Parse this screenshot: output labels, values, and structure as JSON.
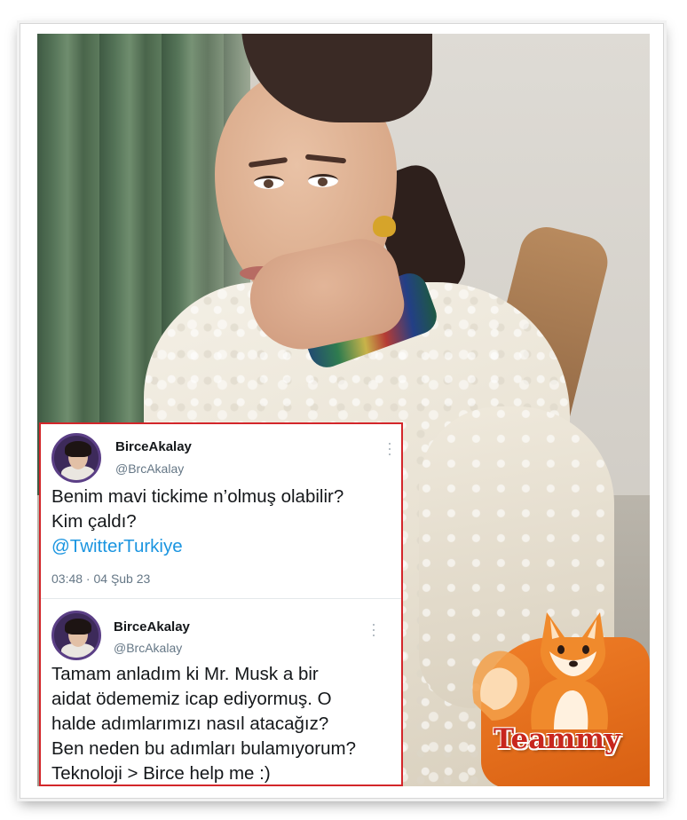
{
  "tweets": [
    {
      "display_name": "BirceAkalay",
      "handle": "@BrcAkalay",
      "text_line1": "Benim mavi tickime n’olmuş olabilir?",
      "text_line2": "Kim çaldı?",
      "mention": "@TwitterTurkiye",
      "timestamp": "03:48 · 04 Şub 23"
    },
    {
      "display_name": "BirceAkalay",
      "handle": "@BrcAkalay",
      "lines": [
        "Tamam anladım ki Mr. Musk a bir",
        "aidat ödememiz icap ediyormuş. O",
        "halde adımlarımızı nasıl atacağız?",
        "Ben neden bu adımları bulamıyorum?",
        "Teknoloji > Birce help me :)"
      ]
    }
  ],
  "watermark": {
    "brand": "Teammy",
    "icon": "fox-icon",
    "color": "#c8261d"
  },
  "colors": {
    "card_border": "#d3262a",
    "mention": "#1b95e0",
    "secondary_text": "#657786"
  }
}
